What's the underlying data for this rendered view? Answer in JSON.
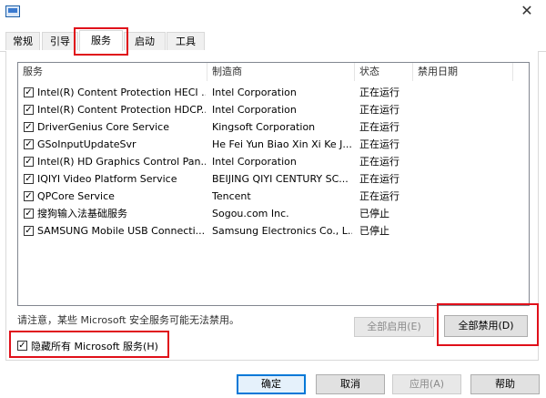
{
  "tabs": [
    {
      "label": "常规"
    },
    {
      "label": "引导"
    },
    {
      "label": "服务"
    },
    {
      "label": "启动"
    },
    {
      "label": "工具"
    }
  ],
  "columns": [
    "服务",
    "制造商",
    "状态",
    "禁用日期"
  ],
  "services": [
    {
      "name": "Intel(R) Content Protection HECI ...",
      "vendor": "Intel Corporation",
      "status": "正在运行",
      "date": ""
    },
    {
      "name": "Intel(R) Content Protection HDCP...",
      "vendor": "Intel Corporation",
      "status": "正在运行",
      "date": ""
    },
    {
      "name": "DriverGenius Core Service",
      "vendor": "Kingsoft Corporation",
      "status": "正在运行",
      "date": ""
    },
    {
      "name": "GSoInputUpdateSvr",
      "vendor": "He Fei Yun Biao Xin Xi Ke J...",
      "status": "正在运行",
      "date": ""
    },
    {
      "name": "Intel(R) HD Graphics Control Pan...",
      "vendor": "Intel Corporation",
      "status": "正在运行",
      "date": ""
    },
    {
      "name": "IQIYI Video Platform Service",
      "vendor": "BEIJING QIYI CENTURY SC...",
      "status": "正在运行",
      "date": ""
    },
    {
      "name": "QPCore Service",
      "vendor": "Tencent",
      "status": "正在运行",
      "date": ""
    },
    {
      "name": "搜狗输入法基础服务",
      "vendor": "Sogou.com Inc.",
      "status": "已停止",
      "date": ""
    },
    {
      "name": "SAMSUNG Mobile USB Connecti...",
      "vendor": "Samsung Electronics Co., L...",
      "status": "已停止",
      "date": ""
    }
  ],
  "note": "请注意，某些 Microsoft 安全服务可能无法禁用。",
  "enable_all_label": "全部启用(E)",
  "disable_all_label": "全部禁用(D)",
  "hide_ms_label": "隐藏所有 Microsoft 服务(H)",
  "buttons": {
    "ok": "确定",
    "cancel": "取消",
    "apply": "应用(A)",
    "help": "帮助"
  },
  "close_glyph": "✕",
  "check_glyph": "✓",
  "colors": {
    "highlight": "#e0101a",
    "accent": "#0078d7"
  }
}
